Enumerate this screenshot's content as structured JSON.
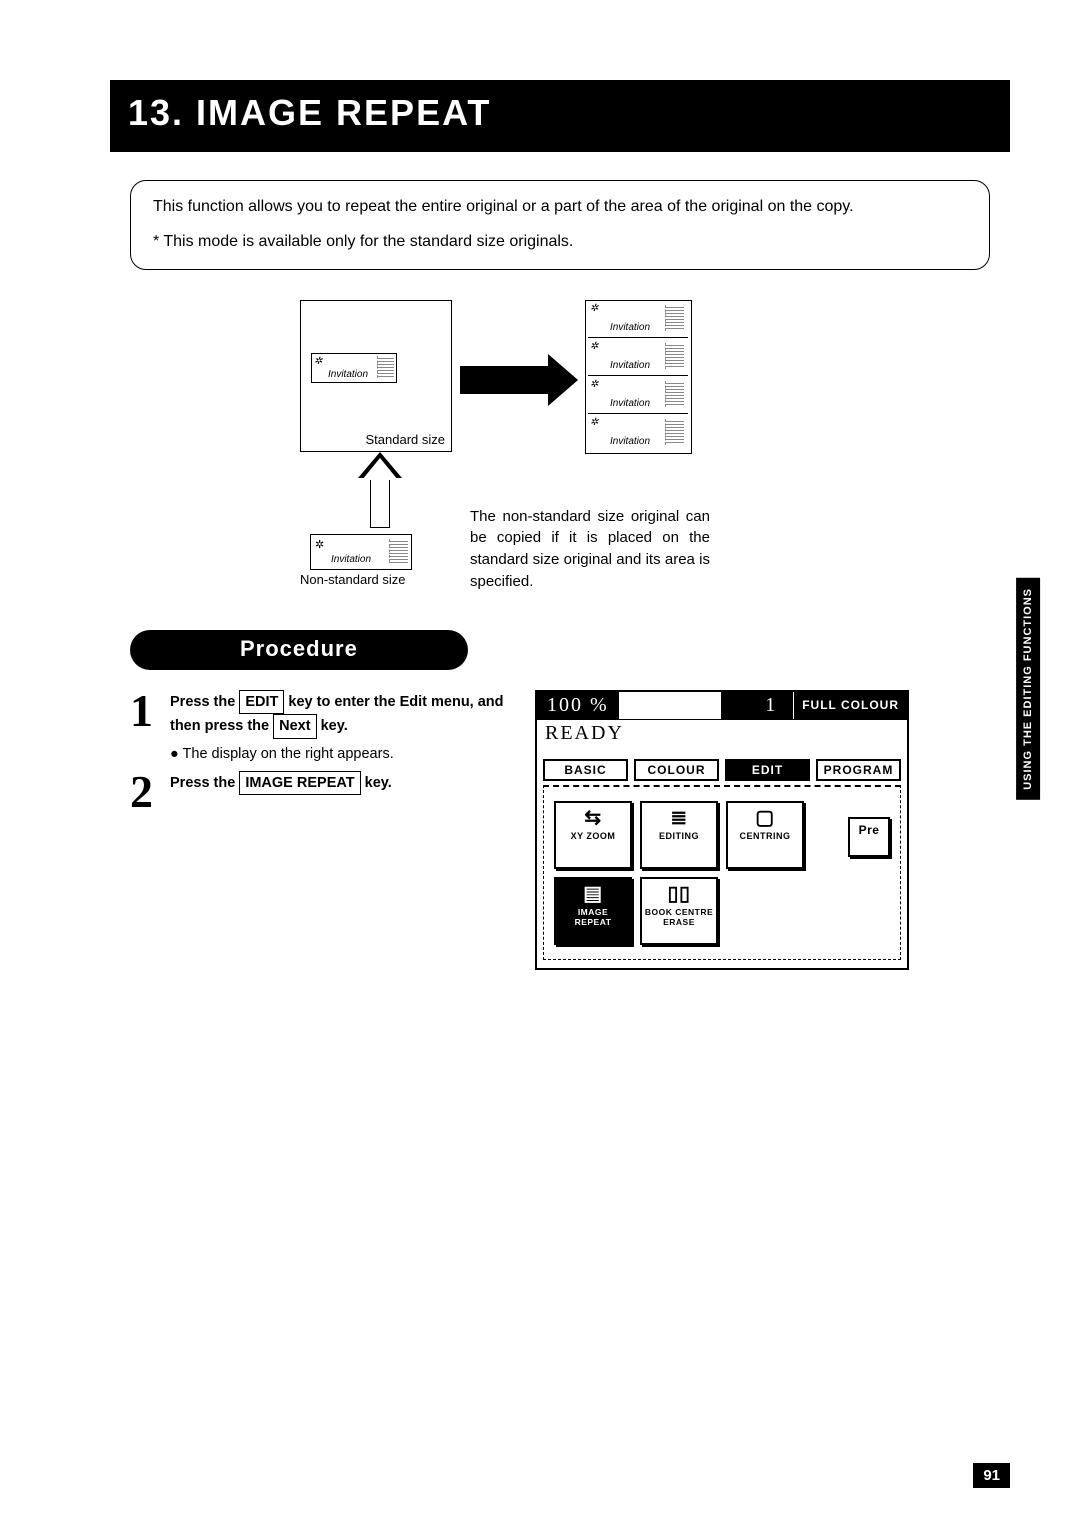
{
  "title": "13. IMAGE REPEAT",
  "intro": {
    "desc": "This function allows you to repeat the entire original or a part of the area of the original on the copy.",
    "note": "* This mode is available only for the standard size originals."
  },
  "diagram": {
    "invitation": "Invitation",
    "standard_caption": "Standard size",
    "nonstandard_caption": "Non-standard size",
    "side_note": "The non-standard size original can be copied if it is placed on the standard size original and its area is specified."
  },
  "procedure_label": "Procedure",
  "steps": {
    "s1": {
      "num": "1",
      "pre": "Press the",
      "key1": "EDIT",
      "mid": "key to enter the Edit menu, and then press the",
      "key2": "Next",
      "post": "key.",
      "sub_bullet": "●",
      "sub_text": "The display on the right appears."
    },
    "s2": {
      "num": "2",
      "pre": "Press the ",
      "key1": "IMAGE REPEAT",
      "post": " key."
    }
  },
  "panel": {
    "zoom": "100  %",
    "copies": "1",
    "mode": "FULL COLOUR",
    "ready": "READY",
    "tabs": {
      "basic": "BASIC",
      "colour": "COLOUR",
      "edit": "EDIT",
      "program": "PROGRAM"
    },
    "buttons": {
      "xyzoom": "XY ZOOM",
      "editing": "EDITING",
      "centring": "CENTRING",
      "pre": "Pre",
      "image_repeat": "IMAGE REPEAT",
      "book_centre": "BOOK CENTRE ERASE"
    }
  },
  "side_tab": "USING THE EDITING FUNCTIONS",
  "page_number": "91"
}
